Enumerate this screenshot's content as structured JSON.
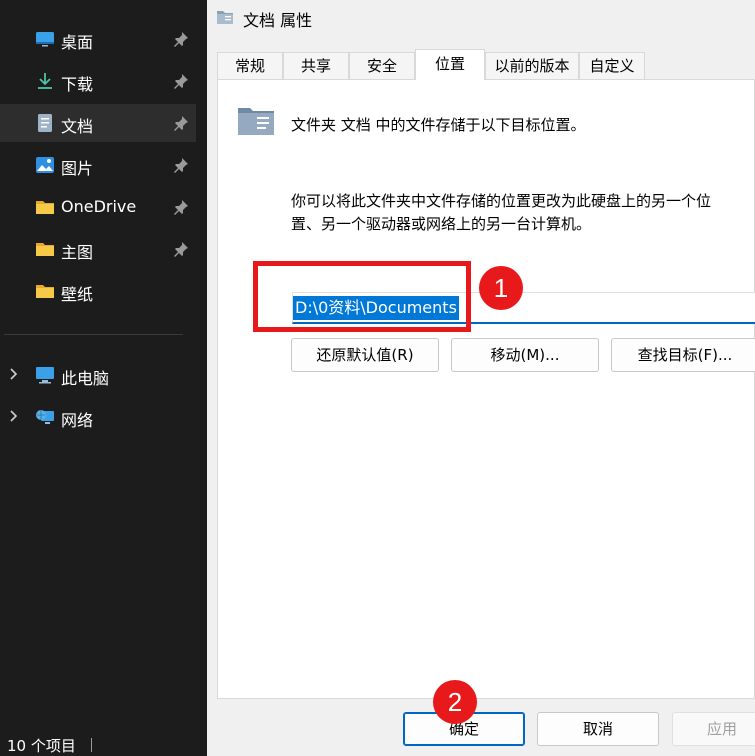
{
  "explorer": {
    "nav_items": [
      {
        "label": "桌面",
        "icon": "desktop-icon",
        "pinned": true
      },
      {
        "label": "下载",
        "icon": "download-icon",
        "pinned": true
      },
      {
        "label": "文档",
        "icon": "document-icon",
        "pinned": true,
        "selected": true
      },
      {
        "label": "图片",
        "icon": "picture-icon",
        "pinned": true
      },
      {
        "label": "OneDrive",
        "icon": "folder-icon",
        "pinned": true
      },
      {
        "label": "主图",
        "icon": "folder-icon",
        "pinned": true
      },
      {
        "label": "壁纸",
        "icon": "folder-icon",
        "pinned": false
      }
    ],
    "tree_items": [
      {
        "label": "此电脑",
        "icon": "computer-icon"
      },
      {
        "label": "网络",
        "icon": "network-icon"
      }
    ],
    "status": "10 个项目"
  },
  "dialog": {
    "title": "文档 属性",
    "tabs": [
      "常规",
      "共享",
      "安全",
      "位置",
      "以前的版本",
      "自定义"
    ],
    "active_tab": "位置",
    "description": "文件夹 文档 中的文件存储于以下目标位置。",
    "info_line1": "你可以将此文件夹中文件存储的位置更改为此硬盘上的另一个位",
    "info_line2": "置、另一个驱动器或网络上的另一台计算机。",
    "path_value": "D:\\0资料\\Documents",
    "buttons": {
      "restore": "还原默认值(R)",
      "move": "移动(M)...",
      "find": "查找目标(F)..."
    },
    "footer": {
      "ok": "确定",
      "cancel": "取消",
      "apply": "应用"
    }
  },
  "annotations": {
    "marker1": "1",
    "marker2": "2",
    "color": "#e8191a"
  },
  "colors": {
    "accent": "#0067c0",
    "selection": "#0078d7",
    "folder": "#f0c24a"
  }
}
